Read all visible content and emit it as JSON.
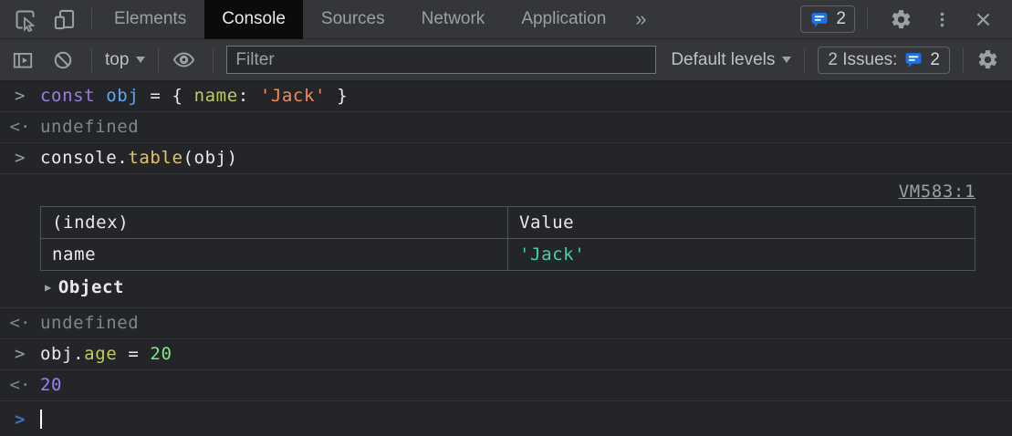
{
  "colors": {
    "accent_blue": "#1a73e8",
    "prompt_blue": "#3d6dc7",
    "keyword_purple": "#9d7ce0",
    "variable_blue": "#61a8f2",
    "property_olive": "#c3c95f",
    "function_yellow": "#e2c55f",
    "string_orange": "#f28b54",
    "number_green": "#7ee787",
    "number_purple": "#9980ff",
    "string_teal": "#43d1a7",
    "muted_gray": "#81868b",
    "icon_gray": "#9aa0a6",
    "bar_bg": "#35363a",
    "console_bg": "#242528"
  },
  "tabbar": {
    "tabs": [
      "Elements",
      "Console",
      "Sources",
      "Network",
      "Application"
    ],
    "active_tab": "Console",
    "overflow": "»",
    "messages_count": "2"
  },
  "toolbar": {
    "context": "top",
    "filter_placeholder": "Filter",
    "levels": "Default levels",
    "issues_label": "2 Issues:",
    "issues_count": "2"
  },
  "console": {
    "prompt_char": ">",
    "result_char": "<·",
    "cmd1": {
      "t1": "const",
      "t2": " ",
      "t3": "obj",
      "t4": " = { ",
      "t5": "name",
      "t6": ": ",
      "t7": "'Jack'",
      "t8": " }"
    },
    "res1": "undefined",
    "cmd2": {
      "t1": "console.",
      "t2": "table",
      "t3": "(obj)"
    },
    "table_out": {
      "link": "VM583:1",
      "headers": [
        "(index)",
        "Value"
      ],
      "row": {
        "key": "name",
        "value": "'Jack'"
      },
      "triangle": "▶",
      "object_preview": "Object"
    },
    "res2": "undefined",
    "cmd3": {
      "t1": "obj.",
      "t2": "age",
      "t3": " = ",
      "t4": "20"
    },
    "res3": "20"
  }
}
